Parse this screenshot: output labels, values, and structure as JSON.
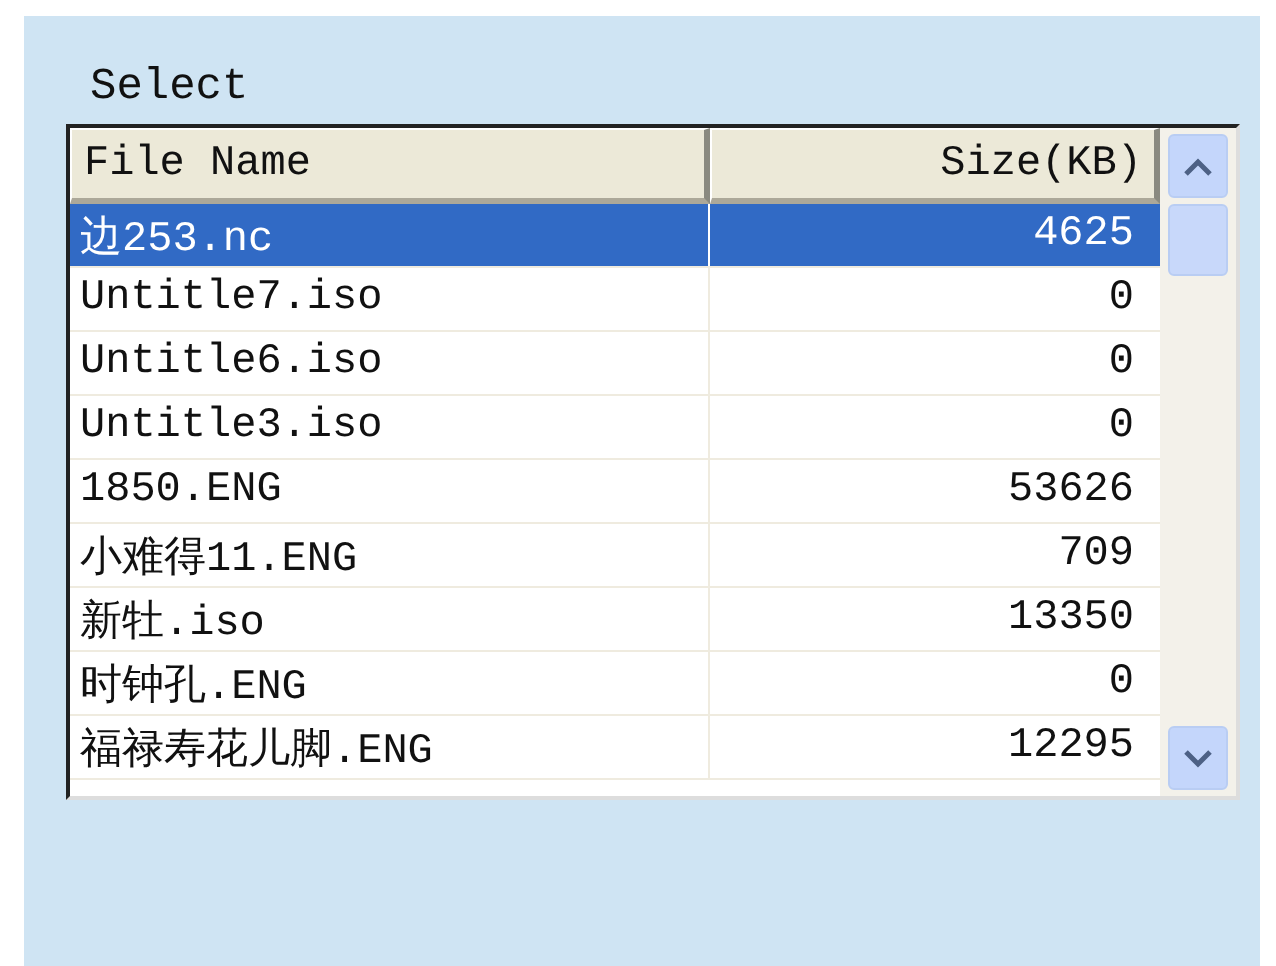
{
  "label": "Select",
  "table": {
    "columns": [
      "File Name",
      "Size(KB)"
    ],
    "rows": [
      {
        "name": "边253.nc",
        "size": "4625",
        "selected": true
      },
      {
        "name": "Untitle7.iso",
        "size": "0",
        "selected": false
      },
      {
        "name": "Untitle6.iso",
        "size": "0",
        "selected": false
      },
      {
        "name": "Untitle3.iso",
        "size": "0",
        "selected": false
      },
      {
        "name": "1850.ENG",
        "size": "53626",
        "selected": false
      },
      {
        "name": "小难得11.ENG",
        "size": "709",
        "selected": false
      },
      {
        "name": "新牡.iso",
        "size": "13350",
        "selected": false
      },
      {
        "name": "时钟孔.ENG",
        "size": "0",
        "selected": false
      },
      {
        "name": "福禄寿花儿脚.ENG",
        "size": "12295",
        "selected": false
      }
    ]
  }
}
